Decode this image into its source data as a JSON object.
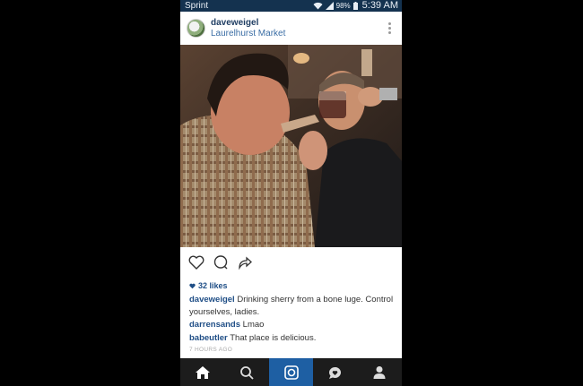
{
  "status_bar": {
    "carrier": "Sprint",
    "battery_percent": "98%",
    "time": "5:39 AM"
  },
  "post": {
    "username": "daveweigel",
    "location": "Laurelhurst Market",
    "likes": "32 likes",
    "caption_user": "daveweigel",
    "caption_text": " Drinking sherry from a bone luge. Control yourselves, ladies.",
    "comments": [
      {
        "user": "darrensands",
        "text": " Lmao"
      },
      {
        "user": "babeutler",
        "text": " That place is delicious."
      }
    ],
    "timestamp": "7 HOURS AGO"
  },
  "icons": {
    "like": "heart-icon",
    "comment": "comment-icon",
    "share": "share-icon",
    "more": "more-options-icon"
  },
  "nav": [
    "home-icon",
    "search-icon",
    "camera-icon",
    "activity-icon",
    "profile-icon"
  ],
  "colors": {
    "status_bar": "#14324f",
    "username": "#1f4e86",
    "nav_active": "#1e5fa3",
    "nav_bg": "#1c1c1c"
  }
}
